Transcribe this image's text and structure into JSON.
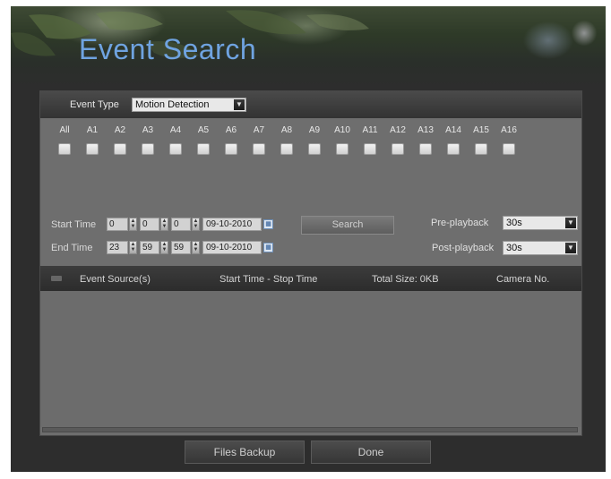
{
  "header": {
    "title": "Event Search"
  },
  "event_type": {
    "label": "Event Type",
    "selected": "Motion Detection",
    "dropdown_icon": "chevron-down-icon"
  },
  "cameras": [
    "All",
    "A1",
    "A2",
    "A3",
    "A4",
    "A5",
    "A6",
    "A7",
    "A8",
    "A9",
    "A10",
    "A11",
    "A12",
    "A13",
    "A14",
    "A15",
    "A16"
  ],
  "start_time": {
    "label": "Start Time",
    "hour": "0",
    "minute": "0",
    "second": "0",
    "date": "09-10-2010"
  },
  "end_time": {
    "label": "End Time",
    "hour": "23",
    "minute": "59",
    "second": "59",
    "date": "09-10-2010"
  },
  "search_label": "Search",
  "pre_playback": {
    "label": "Pre-playback",
    "value": "30s"
  },
  "post_playback": {
    "label": "Post-playback",
    "value": "30s"
  },
  "results": {
    "col_source": "Event Source(s)",
    "col_time": "Start Time - Stop Time",
    "total_size": "Total Size: 0KB",
    "col_camera": "Camera No."
  },
  "buttons": {
    "backup": "Files Backup",
    "done": "Done"
  },
  "colors": {
    "title": "#6fa3e0",
    "panel": "#6e6e6e",
    "frame": "#2d2d2d"
  }
}
